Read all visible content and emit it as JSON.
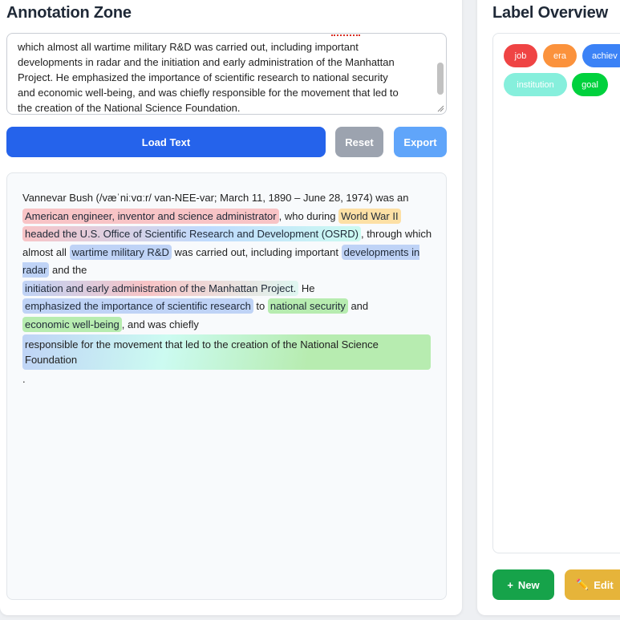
{
  "left_panel": {
    "title": "Annotation Zone",
    "source_text": {
      "line0_before": "which almost all wartime military R&D was carried out, including important ",
      "misspelled_hint": "",
      "line1": "developments in radar and the initiation and early administration of the Manhattan",
      "line2": "Project. He emphasized the importance of scientific research to national security",
      "line3": "and economic well-being, and was chiefly responsible for the movement that led to",
      "line4": "the creation of the National Science Foundation."
    },
    "buttons": {
      "load": "Load Text",
      "reset": "Reset",
      "export": "Export"
    },
    "annotated": {
      "intro": "Vannevar Bush (/væˈniːvɑːr/ van-NEE-var; March 11, 1890 – June 28, 1974) was an ",
      "seg1": "American engineer, inventor and science administrator",
      "t1": ", who during ",
      "seg2": "World War II",
      "t2": " ",
      "seg3": "headed the U.S. Office of Scientific Research and Development (OSRD)",
      "t3": ", through which almost all ",
      "seg4": "wartime military R&D",
      "t4": " was carried out, including important ",
      "seg5": "developments in radar",
      "t5": " and the ",
      "seg6": "initiation and early administration of the Manhattan Project.",
      "t6": " He ",
      "seg7": "emphasized the importance of scientific research",
      "t7": " to ",
      "seg8": "national security",
      "t8": " and ",
      "seg9": "economic well-being",
      "t9": ", and was chiefly ",
      "seg10": "responsible for the movement that led to the creation of the National Science Foundation",
      "t10": "."
    }
  },
  "right_panel": {
    "title": "Label Overview",
    "tags": [
      {
        "label": "job",
        "color": "#ef4444"
      },
      {
        "label": "era",
        "color": "#fb923c"
      },
      {
        "label": "achiev",
        "color": "#3b82f6"
      },
      {
        "label": "institution",
        "color": "#86efdc"
      },
      {
        "label": "goal",
        "color": "#00d13d"
      }
    ],
    "buttons": {
      "new_icon": "+",
      "new": "New",
      "edit_icon": "✏️",
      "edit": "Edit"
    }
  }
}
